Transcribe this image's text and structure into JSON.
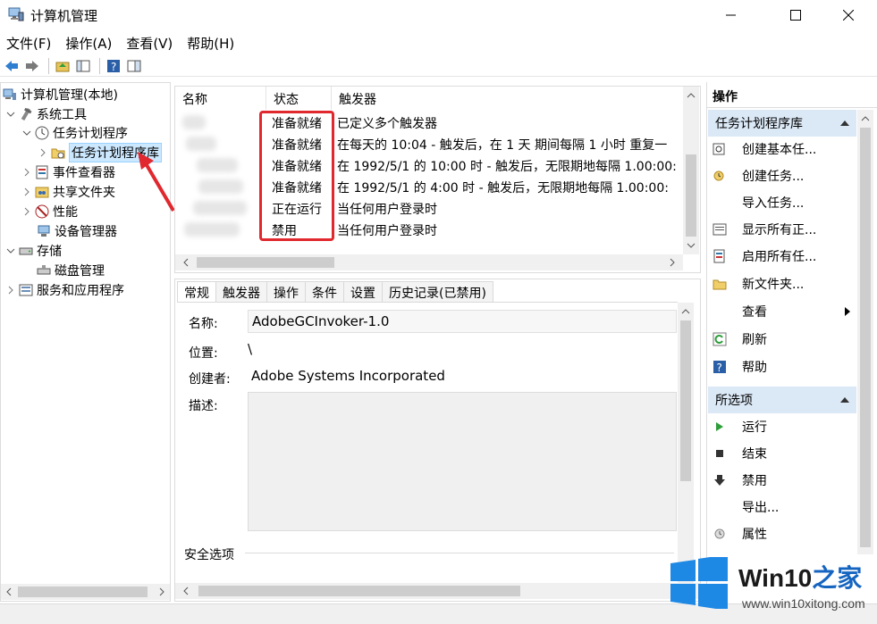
{
  "window": {
    "title": "计算机管理"
  },
  "menu": [
    "文件(F)",
    "操作(A)",
    "查看(V)",
    "帮助(H)"
  ],
  "toolbar": [
    "back-icon",
    "forward-icon",
    "up-folder-icon",
    "show-hide-tree-icon",
    "help-icon",
    "properties-icon"
  ],
  "tree": {
    "items": [
      {
        "label": "计算机管理(本地)",
        "icon": "computer-management-icon"
      },
      {
        "label": "系统工具",
        "icon": "system-tools-icon"
      },
      {
        "label": "任务计划程序",
        "icon": "clock-icon"
      },
      {
        "label": "任务计划程序库",
        "icon": "folder-icon"
      },
      {
        "label": "事件查看器",
        "icon": "event-viewer-icon"
      },
      {
        "label": "共享文件夹",
        "icon": "shared-folder-icon"
      },
      {
        "label": "性能",
        "icon": "performance-icon"
      },
      {
        "label": "设备管理器",
        "icon": "device-manager-icon"
      },
      {
        "label": "存储",
        "icon": "storage-icon"
      },
      {
        "label": "磁盘管理",
        "icon": "disk-icon"
      },
      {
        "label": "服务和应用程序",
        "icon": "services-icon"
      }
    ]
  },
  "task_list": {
    "headers": [
      "名称",
      "状态",
      "触发器"
    ],
    "rows": [
      {
        "status": "准备就绪",
        "trigger": "已定义多个触发器"
      },
      {
        "status": "准备就绪",
        "trigger": "在每天的 10:04 - 触发后，在 1 天 期间每隔 1 小时 重复一"
      },
      {
        "status": "准备就绪",
        "trigger": "在 1992/5/1 的 10:00 时 - 触发后，无限期地每隔 1.00:00:"
      },
      {
        "status": "准备就绪",
        "trigger": "在 1992/5/1 的 4:00 时 - 触发后，无限期地每隔 1.00:00:"
      },
      {
        "status": "正在运行",
        "trigger": "当任何用户登录时"
      },
      {
        "status": "禁用",
        "trigger": "当任何用户登录时"
      }
    ]
  },
  "details": {
    "tabs": [
      "常规",
      "触发器",
      "操作",
      "条件",
      "设置",
      "历史记录(已禁用)"
    ],
    "name_label": "名称:",
    "name_value": "AdobeGCInvoker-1.0",
    "location_label": "位置:",
    "location_value": "\\",
    "author_label": "创建者:",
    "author_value": "Adobe Systems Incorporated",
    "description_label": "描述:",
    "security_label": "安全选项"
  },
  "actions": {
    "title": "操作",
    "group1": "任务计划程序库",
    "group1_items": [
      {
        "label": "创建基本任...",
        "icon": "create-basic-task-icon"
      },
      {
        "label": "创建任务...",
        "icon": "create-task-icon"
      },
      {
        "label": "导入任务...",
        "icon": ""
      },
      {
        "label": "显示所有正...",
        "icon": "display-running-icon"
      },
      {
        "label": "启用所有任...",
        "icon": "enable-all-icon"
      },
      {
        "label": "新文件夹...",
        "icon": "new-folder-icon"
      },
      {
        "label": "查看",
        "icon": ""
      },
      {
        "label": "刷新",
        "icon": "refresh-icon"
      },
      {
        "label": "帮助",
        "icon": "help-icon"
      }
    ],
    "group2": "所选项",
    "group2_items": [
      {
        "label": "运行",
        "icon": "run-icon"
      },
      {
        "label": "结束",
        "icon": "end-icon"
      },
      {
        "label": "禁用",
        "icon": "disable-icon"
      },
      {
        "label": "导出...",
        "icon": ""
      },
      {
        "label": "属性",
        "icon": "properties-icon"
      }
    ]
  },
  "watermark": {
    "brand": "Win10",
    "brand_zh": "之家",
    "site": "www.win10xitong.com"
  },
  "colors": {
    "highlight": "#e0282e",
    "selection": "#cce8ff",
    "group_header": "#dbe8f6",
    "logo_blue": "#1e88e5"
  }
}
